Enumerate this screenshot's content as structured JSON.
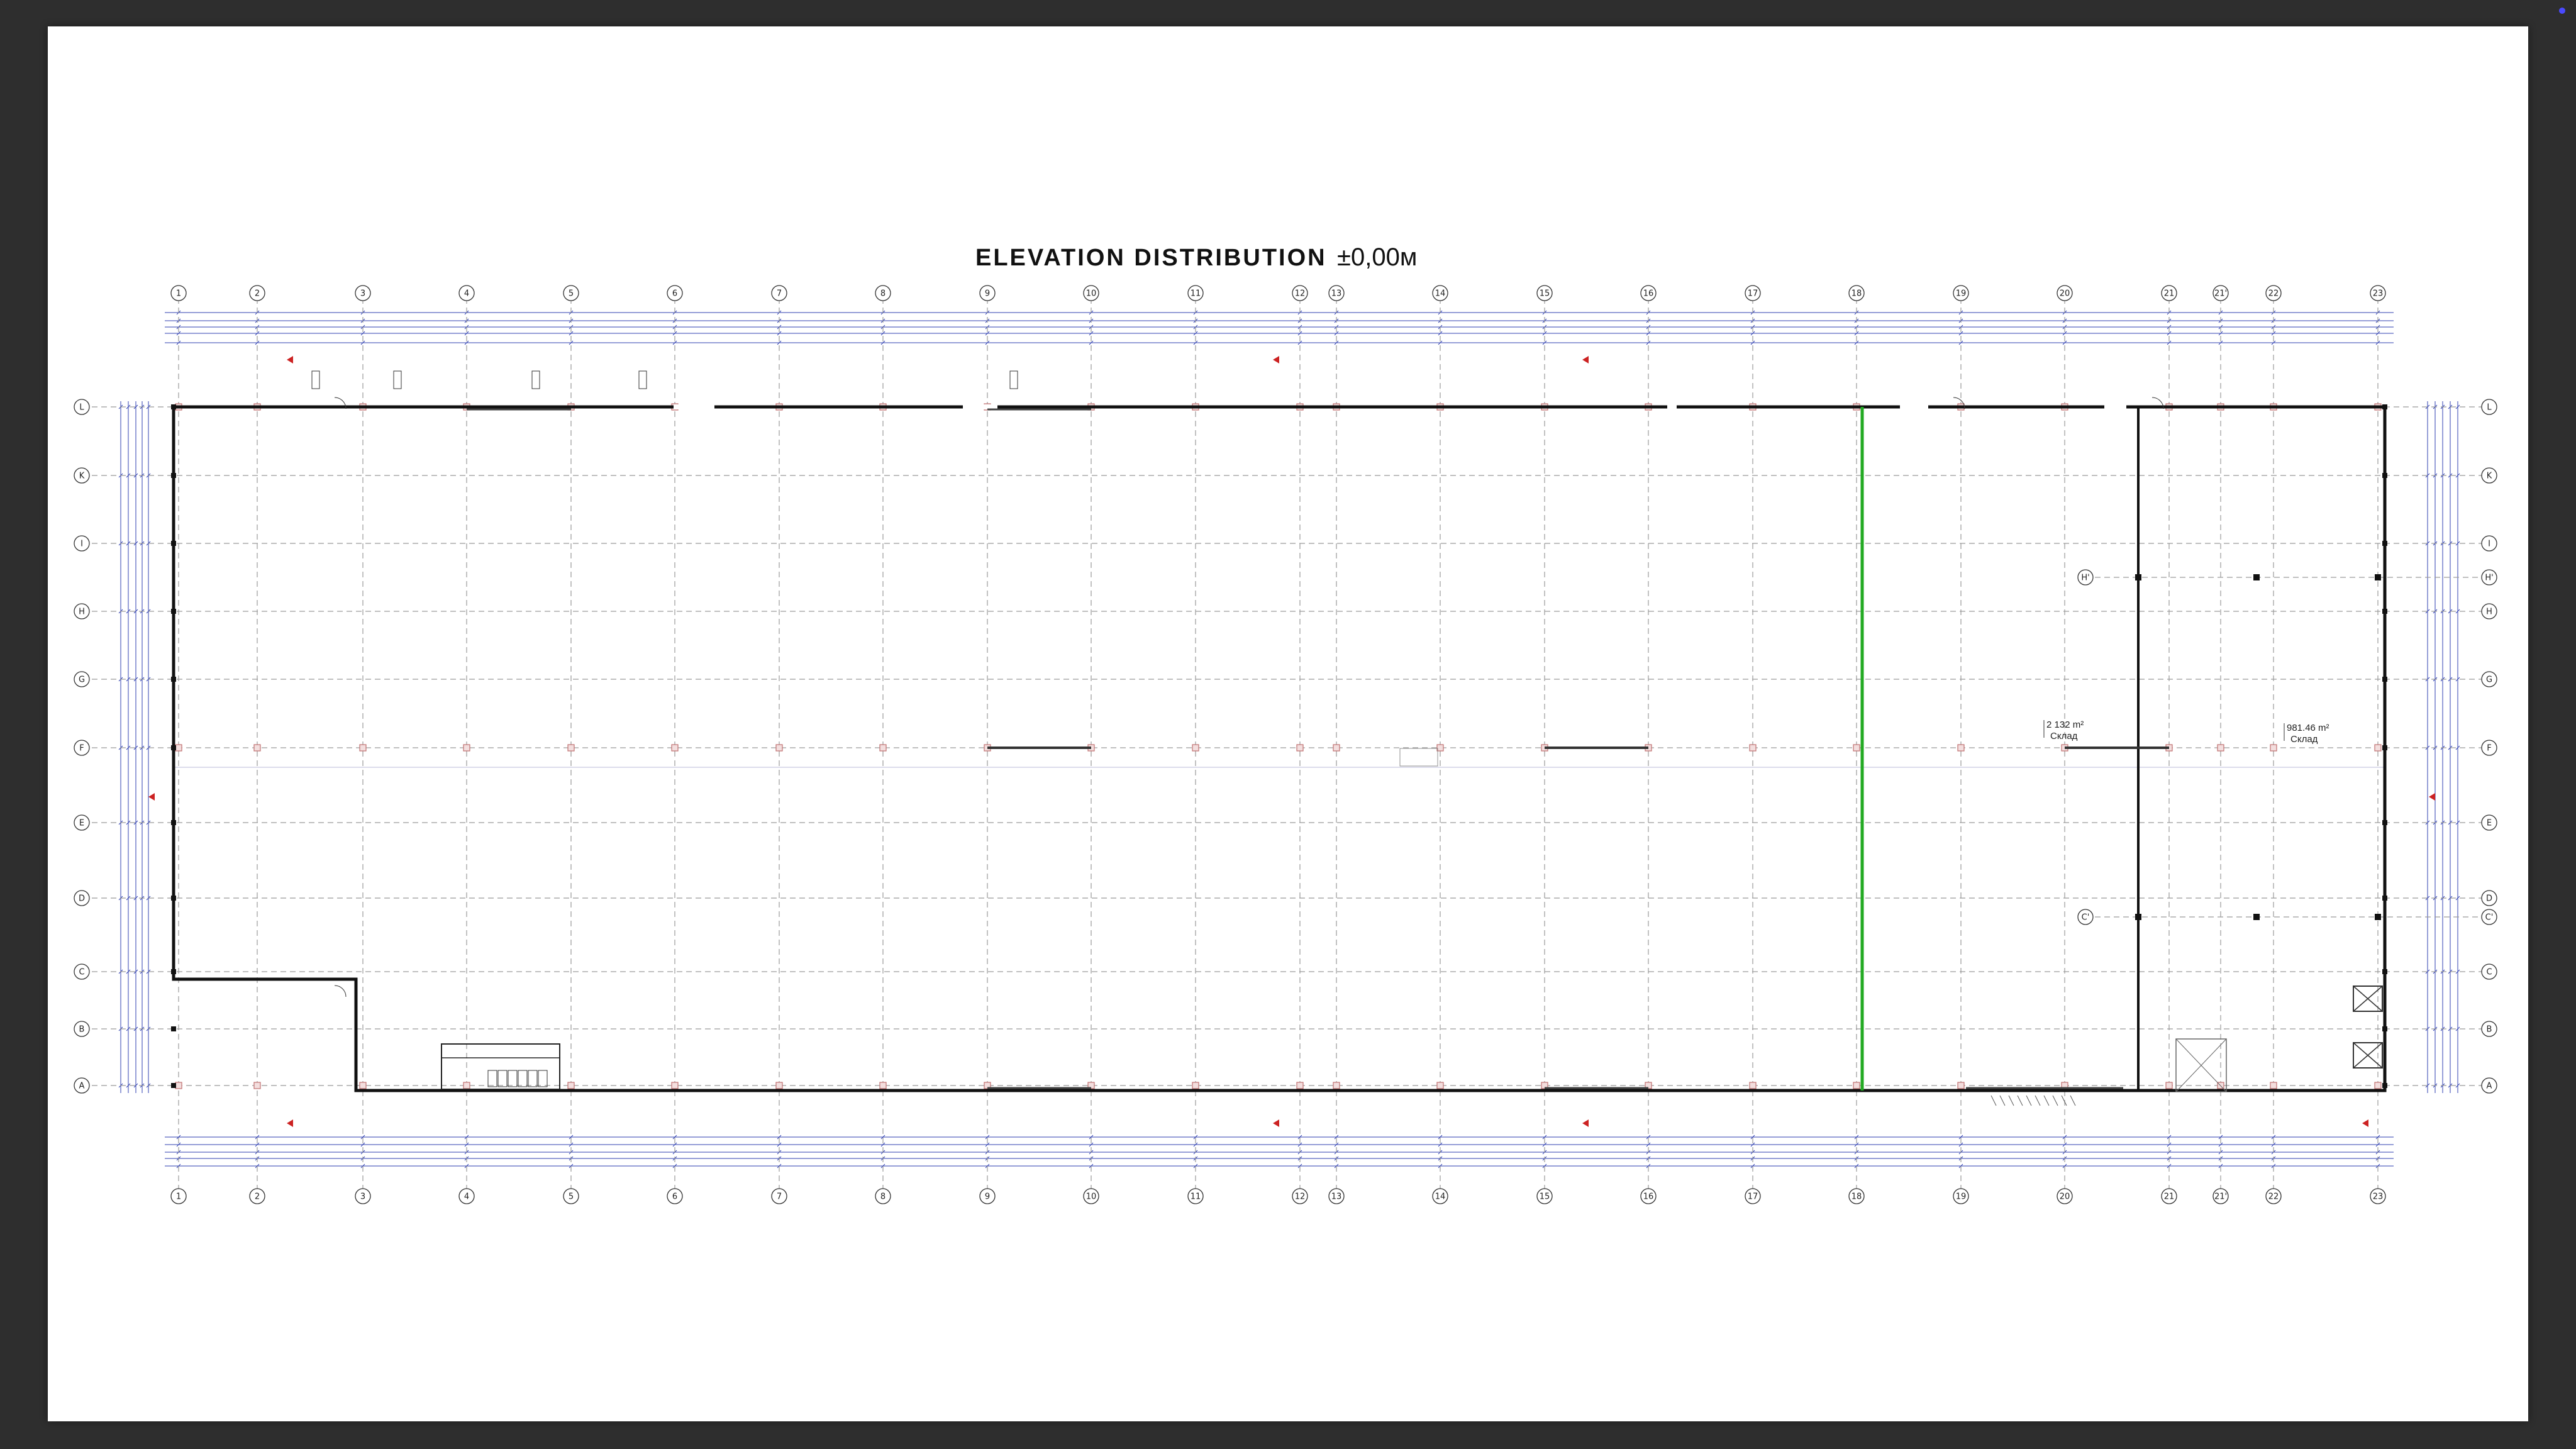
{
  "drawing": {
    "title": "ELEVATION DISTRIBUTION",
    "level": "±0,00м"
  },
  "grid": {
    "columns": [
      "1",
      "2",
      "3",
      "4",
      "5",
      "6",
      "7",
      "8",
      "9",
      "10",
      "11",
      "12",
      "13",
      "14",
      "15",
      "16",
      "17",
      "18",
      "19",
      "20",
      "21",
      "21'",
      "22",
      "23"
    ],
    "rows": [
      "L",
      "K",
      "I",
      "H",
      "G",
      "F",
      "E",
      "D",
      "C",
      "B",
      "A"
    ],
    "partial_rows": [
      "H'",
      "C'"
    ]
  },
  "rooms": [
    {
      "area": "2 132 m²",
      "name": "Склад"
    },
    {
      "area": "981.46 m²",
      "name": "Склад"
    }
  ],
  "colors": {
    "page_background": "#2e2e2e",
    "sheet": "#ffffff",
    "wall": "#111111",
    "grid_line": "#9a9a9a",
    "dimension": "#2f3fb0",
    "column": "#c07070",
    "fire_wall": "#22aa22",
    "arrow": "#cc2222"
  }
}
